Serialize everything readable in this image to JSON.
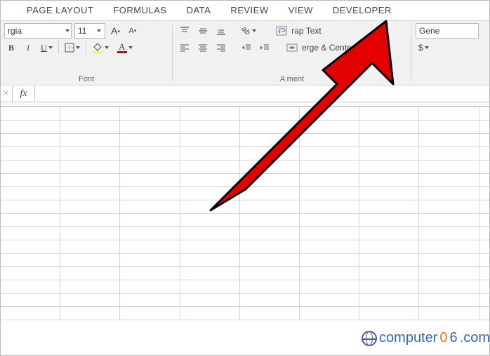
{
  "tabs": {
    "page_layout": "PAGE LAYOUT",
    "formulas": "FORMULAS",
    "data": "DATA",
    "review": "REVIEW",
    "view": "VIEW",
    "developer": "DEVELOPER"
  },
  "font": {
    "name_value": "rgia",
    "size_value": "11",
    "bold_glyph": "B",
    "italic_glyph": "I",
    "underline_glyph": "U",
    "grow_label": "A",
    "shrink_label": "A",
    "fontcolor_label": "A",
    "group_label": "Font"
  },
  "alignment": {
    "wrap_text_label": "rap Text",
    "merge_center_label": "erge & Center",
    "orientation_label": "ab",
    "group_label": "A           ment"
  },
  "number": {
    "format_value": "Gene",
    "currency_label": "$"
  },
  "formula_bar": {
    "fx_label": "fx",
    "value": ""
  },
  "watermark": {
    "text_main": "computer",
    "text_zero": "0",
    "text_six": "6",
    "text_dotcom": ".com"
  }
}
